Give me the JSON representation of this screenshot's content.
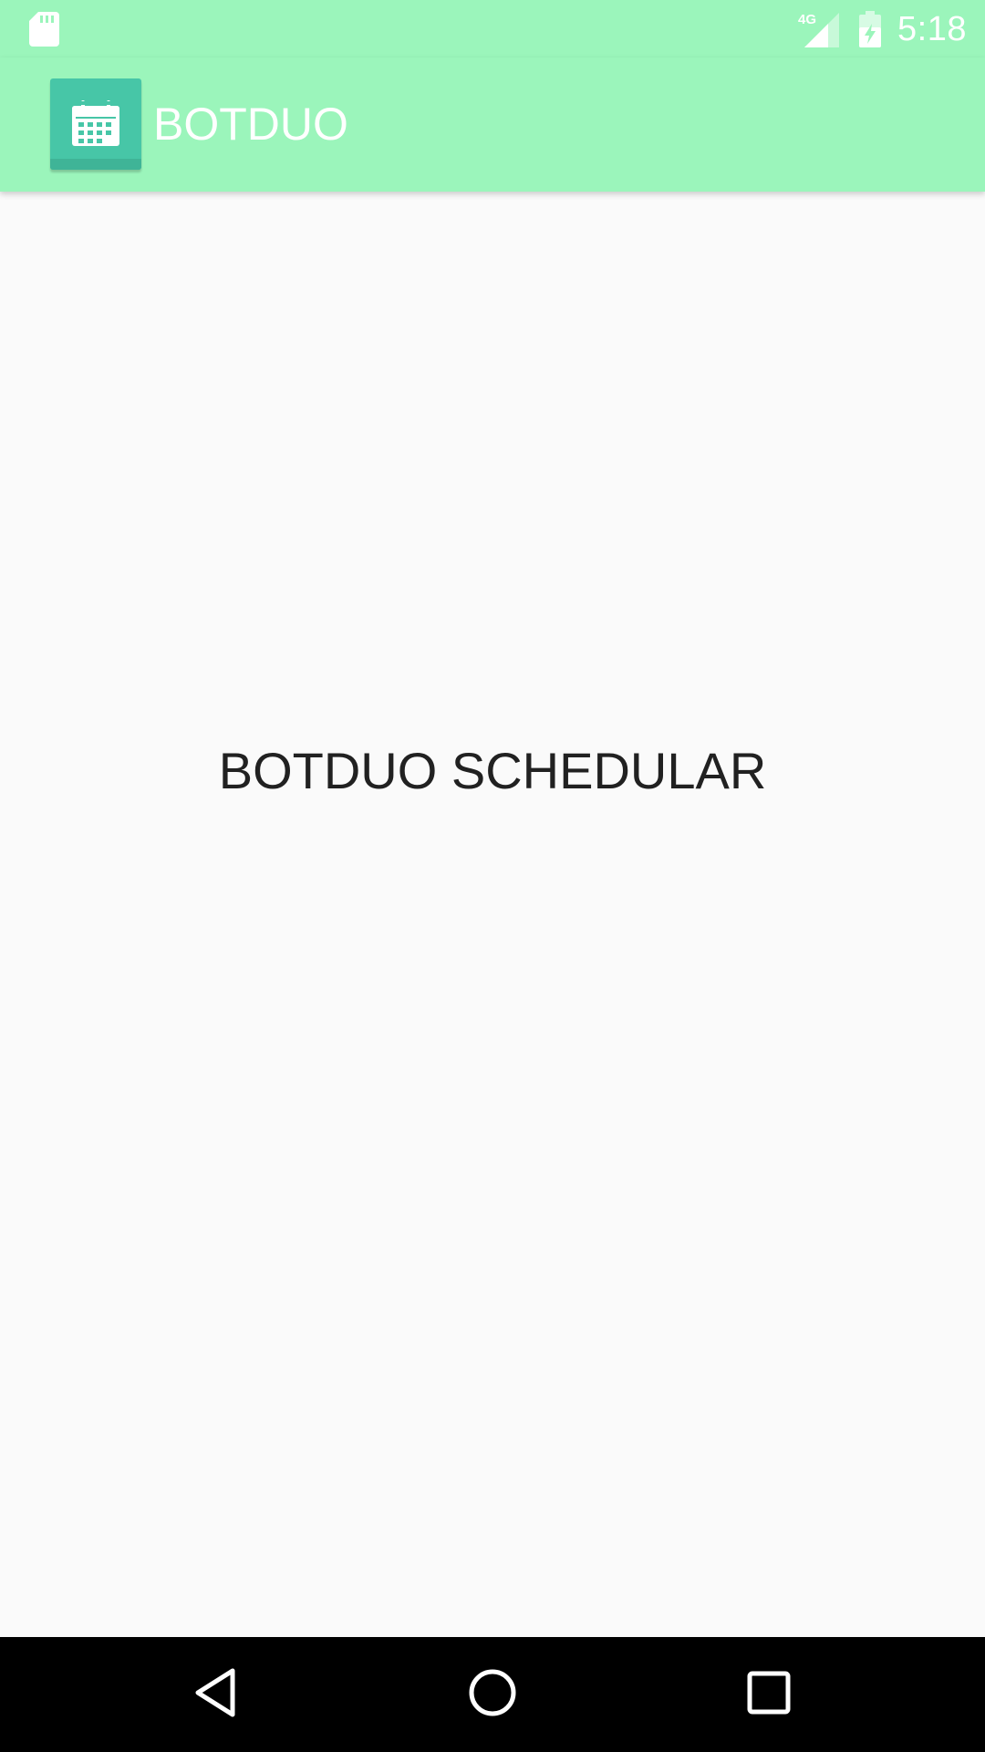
{
  "status_bar": {
    "time": "5:18",
    "network_label": "4G",
    "icons": [
      "sd-card-icon",
      "signal-icon",
      "battery-icon"
    ]
  },
  "app_bar": {
    "title": "BOTDUO",
    "logo_icon": "calendar-icon",
    "background_color": "#9bf5bb",
    "logo_color": "#47c6a7"
  },
  "main": {
    "heading": "BOTDUO SCHEDULAR"
  },
  "nav_bar": {
    "buttons": [
      "back-icon",
      "home-icon",
      "recents-icon"
    ]
  }
}
